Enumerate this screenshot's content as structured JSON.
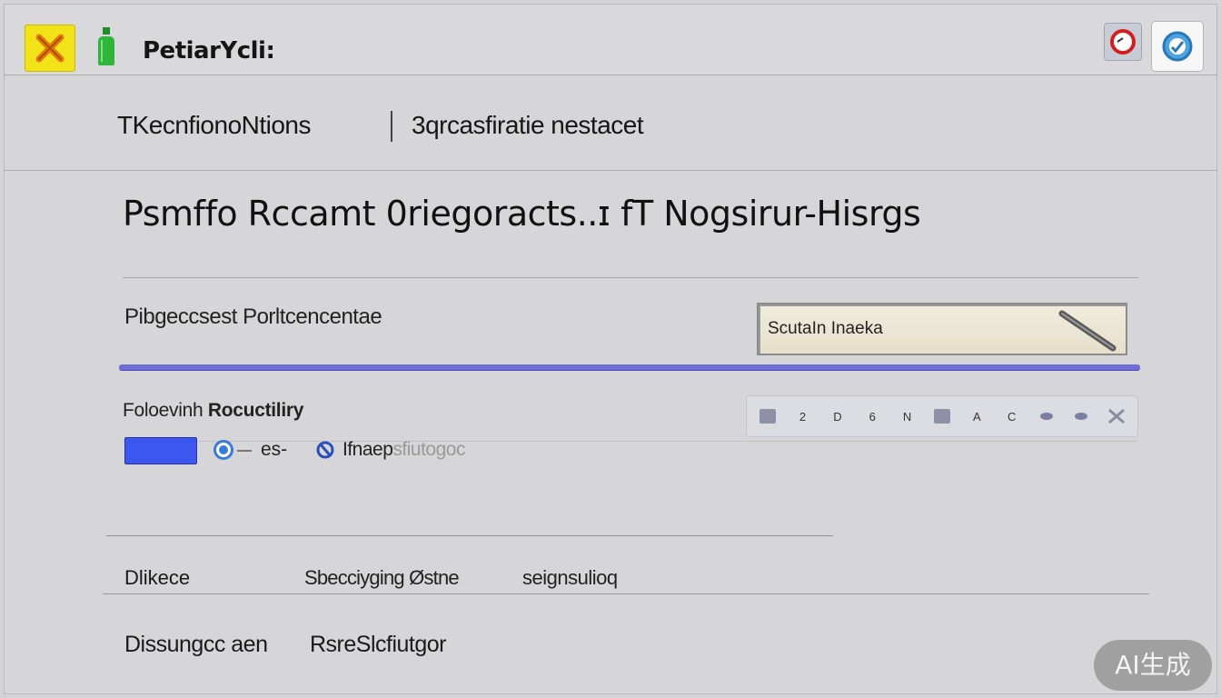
{
  "window": {
    "title": "PetiarYcli:",
    "icons": {
      "app": "close-x-icon",
      "bottle": "bottle-icon",
      "stop": "stop-icon",
      "sync": "sync-icon"
    }
  },
  "tabs": [
    {
      "label": "TKecnfionoNtions"
    },
    {
      "label": "3qrcasfiratie nestacet"
    }
  ],
  "page": {
    "title": "Psmffo Rccamt 0riegoracts..ɪ fT Nogsirur-Hisrgs"
  },
  "fields": {
    "percentage_label": "Pibgeccsest Porltcencentae",
    "search_placeholder": "ScutaIn Inaeka"
  },
  "policy": {
    "label_plain": "Foloevinh ",
    "label_bold": "Rocuctiliry",
    "option_1": "es-",
    "option_2_main": "Ifnaep",
    "option_2_faded": "sfiutogoc"
  },
  "mini_toolbar": {
    "items": [
      "",
      "2",
      "D",
      "6",
      "N",
      "",
      "A",
      "C",
      "",
      "",
      ""
    ]
  },
  "details": {
    "label": "Dlikece",
    "value_1": "Sbecciyging Østne",
    "value_2": "seignsulioq"
  },
  "footer": {
    "label": "Dissungcc aen",
    "value": "RsreSlcfiutgor"
  },
  "watermark": "AI生成",
  "colors": {
    "accent_blue": "#3c57ef",
    "progress": "#6d6fd4",
    "icon_yellow": "#f2e21a",
    "icon_green": "#2fb53a"
  }
}
